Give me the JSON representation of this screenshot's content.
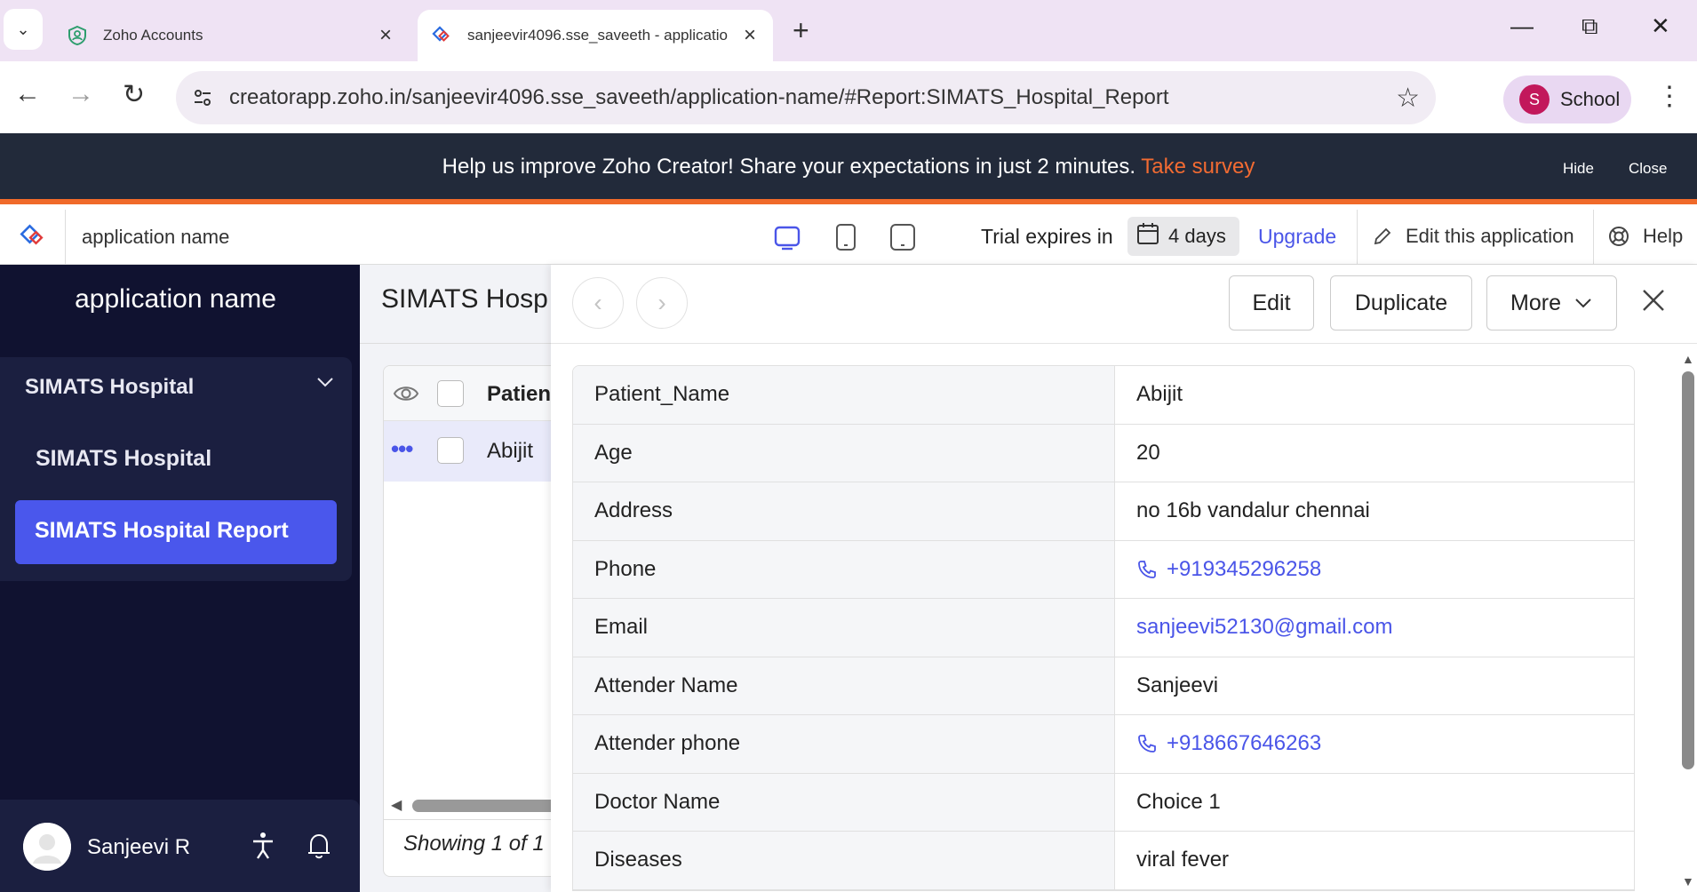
{
  "browser": {
    "tabs": [
      {
        "title": "Zoho Accounts"
      },
      {
        "title": "sanjeevir4096.sse_saveeth - applicatio"
      }
    ],
    "url": "creatorapp.zoho.in/sanjeevir4096.sse_saveeth/application-name/#Report:SIMATS_Hospital_Report",
    "profile": {
      "initial": "S",
      "label": "School"
    }
  },
  "banner": {
    "message": "Help us improve Zoho Creator! Share your expectations in just 2 minutes.",
    "link": "Take survey",
    "hide": "Hide",
    "close": "Close"
  },
  "header": {
    "app_name": "application name",
    "trial_label": "Trial expires in",
    "days": "4 days",
    "upgrade": "Upgrade",
    "edit_app": "Edit this application",
    "help": "Help"
  },
  "sidebar": {
    "title": "application name",
    "group": "SIMATS Hospital",
    "items": [
      {
        "label": "SIMATS Hospital"
      },
      {
        "label": "SIMATS Hospital Report"
      }
    ],
    "user": "Sanjeevi R"
  },
  "report": {
    "title": "SIMATS Hosp",
    "column": "Patien",
    "cell": "Abijit",
    "showing": "Showing 1 of 1"
  },
  "detail": {
    "buttons": {
      "edit": "Edit",
      "duplicate": "Duplicate",
      "more": "More"
    },
    "fields": [
      {
        "label": "Patient_Name",
        "value": "Abijit"
      },
      {
        "label": "Age",
        "value": "20"
      },
      {
        "label": "Address",
        "value": "no 16b vandalur chennai"
      },
      {
        "label": "Phone",
        "value": "+919345296258"
      },
      {
        "label": "Email",
        "value": "sanjeevi52130@gmail.com"
      },
      {
        "label": "Attender Name",
        "value": "Sanjeevi"
      },
      {
        "label": "Attender phone",
        "value": "+918667646263"
      },
      {
        "label": "Doctor Name",
        "value": "Choice 1"
      },
      {
        "label": "Diseases",
        "value": "viral fever"
      }
    ]
  },
  "colors": {
    "accent": "#4a57ec",
    "banner_bg": "#222a3a",
    "survey_link": "#f26b32",
    "sidebar_bg": "#101230"
  }
}
